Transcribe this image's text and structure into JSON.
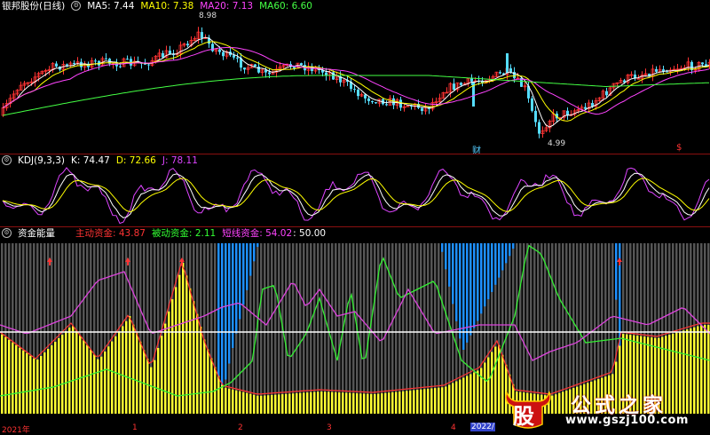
{
  "kline": {
    "title": "银邦股份(日线)",
    "ma": [
      {
        "label": "MA5: 7.44",
        "color": "#ffffff"
      },
      {
        "label": "MA10: 7.38",
        "color": "#ffff00"
      },
      {
        "label": "MA20: 7.13",
        "color": "#ff44ff"
      },
      {
        "label": "MA60: 6.60",
        "color": "#44ff44"
      }
    ],
    "high_label": "8.98",
    "low_label": "4.99",
    "marker_cai": "财",
    "marker_s": "$"
  },
  "kdj": {
    "title": "KDJ(9,3,3)",
    "k": "K: 74.47",
    "d": "D: 72.66",
    "j": "J: 78.11"
  },
  "fund": {
    "title": "资金能量",
    "main": "主动资金: 43.87",
    "passive": "被动资金: 2.11",
    "short": "短线资金: 54.02",
    "level": ": 50.00"
  },
  "axis": {
    "labels": [
      "2021年",
      "1",
      "2",
      "3",
      "4",
      "2022/"
    ]
  },
  "watermark": {
    "logo": "股",
    "title": "公式之家",
    "url": "www.gszj100.com"
  },
  "colors": {
    "up": "#ff3333",
    "down": "#55ddff",
    "main_fund": "#ffff33",
    "short_fund": "#1e90ff",
    "passive_fund": "#ff3333",
    "kdj_k": "#ffffff",
    "kdj_d": "#ffff00",
    "kdj_j": "#dd44ff"
  }
}
